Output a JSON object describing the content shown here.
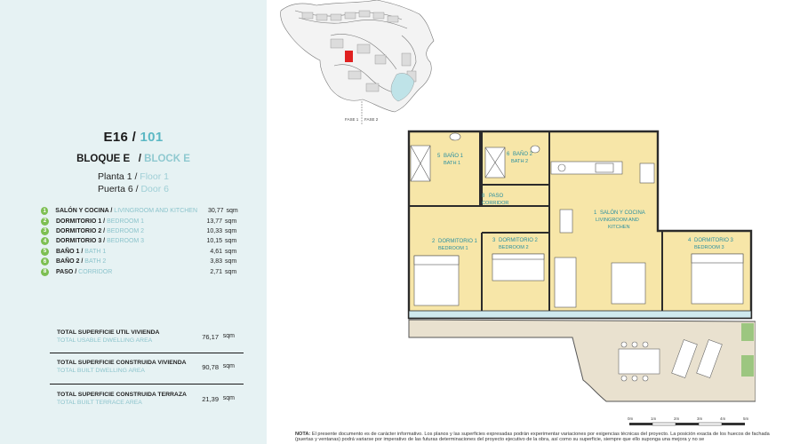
{
  "unit": {
    "code": "E16 /",
    "code_en": "101"
  },
  "block": {
    "label": "BLOQUE E",
    "slash": "/",
    "label_en": "BLOCK E"
  },
  "floor": {
    "label": "Planta 1",
    "slash": "/",
    "label_en": "Floor 1"
  },
  "door": {
    "label": "Puerta 6",
    "slash": "/",
    "label_en": "Door 6"
  },
  "rooms": [
    {
      "num": "1",
      "es": "SALÓN Y COCINA",
      "en": "LIVINGROOM AND KITCHEN",
      "area": "30,77",
      "unit": "sqm"
    },
    {
      "num": "2",
      "es": "DORMITORIO 1",
      "en": "BEDROOM 1",
      "area": "13,77",
      "unit": "sqm"
    },
    {
      "num": "3",
      "es": "DORMITORIO 2",
      "en": "BEDROOM 2",
      "area": "10,33",
      "unit": "sqm"
    },
    {
      "num": "4",
      "es": "DORMITORIO 3",
      "en": "BEDROOM 3",
      "area": "10,15",
      "unit": "sqm"
    },
    {
      "num": "5",
      "es": "BAÑO 1",
      "en": "BATH 1",
      "area": "4,61",
      "unit": "sqm"
    },
    {
      "num": "6",
      "es": "BAÑO 2",
      "en": "BATH 2",
      "area": "3,83",
      "unit": "sqm"
    },
    {
      "num": "8",
      "es": "PASO",
      "en": "CORRIDOR",
      "area": "2,71",
      "unit": "sqm"
    }
  ],
  "totals": [
    {
      "es": "TOTAL SUPERFICIE UTIL VIVIENDA",
      "en": "TOTAL USABLE DWELLING AREA",
      "value": "76,17",
      "unit": "sqm"
    },
    {
      "es": "TOTAL SUPERFICIE CONSTRUIDA VIVIENDA",
      "en": "TOTAL BUILT DWELLING AREA",
      "value": "90,78",
      "unit": "sqm"
    },
    {
      "es": "TOTAL SUPERFICIE CONSTRUIDA TERRAZA",
      "en": "TOTAL BUILT TERRACE AREA",
      "value": "21,39",
      "unit": "sqm"
    }
  ],
  "map": {
    "fase1": "FASE 1",
    "fase2": "FASE 2"
  },
  "plan_labels": {
    "bath1": {
      "num": "5",
      "es": "BAÑO 1",
      "en": "BATH 1"
    },
    "bath2": {
      "num": "6",
      "es": "BAÑO 2",
      "en": "BATH 2"
    },
    "corridor": {
      "num": "8",
      "es": "PASO",
      "en": "CORRIDOR"
    },
    "bed1": {
      "num": "2",
      "es": "DORMITORIO 1",
      "en": "BEDROOM 1"
    },
    "bed2": {
      "num": "3",
      "es": "DORMITORIO 2",
      "en": "BEDROOM 2"
    },
    "living": {
      "num": "1",
      "es": "SALÓN Y COCINA",
      "en1": "LIVINGROOM AND",
      "en2": "KITCHEN"
    },
    "bed3": {
      "num": "4",
      "es": "DORMITORIO 3",
      "en": "BEDROOM 3"
    }
  },
  "scale": [
    "0m",
    "1m",
    "2m",
    "3m",
    "4m",
    "5m"
  ],
  "note": {
    "label": "NOTA:",
    "text": "El presente documento es de carácter informativo. Los planos y las superficies expresadas podrán experimentar variaciones por exigencias técnicas del proyecto. La posición exacta de los huecos de fachada (puertas y ventanas) podrá variarse por imperativo de las futuras determinaciones del proyecto ejecutivo de la obra, así como su superficie, siempre que ello suponga una mejora y no se"
  },
  "colors": {
    "panel_bg": "#e6f2f3",
    "accent": "#5bb8c4",
    "room_fill": "#f7e6a8",
    "terrace_fill": "#e9e1cf",
    "badge": "#7dbf52"
  }
}
